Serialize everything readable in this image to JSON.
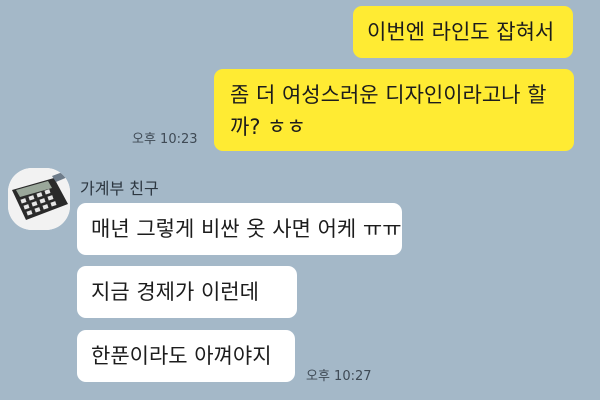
{
  "chat": {
    "sent": [
      {
        "text": "이번엔 라인도 잡혀서"
      },
      {
        "text": "좀 더 여성스러운 디자인이라고나 할까? ㅎㅎ"
      }
    ],
    "sent_time": "오후 10:23",
    "friend_name": "가계부 친구",
    "avatar_icon": "calculator-icon",
    "received": [
      {
        "text": "매년 그렇게 비싼 옷 사면 어케 ㅠㅠ"
      },
      {
        "text": "지금 경제가 이런데"
      },
      {
        "text": "한푼이라도 아껴야지"
      }
    ],
    "received_time": "오후 10:27"
  },
  "colors": {
    "background": "#a4b8c8",
    "sent_bubble": "#ffeb33",
    "received_bubble": "#ffffff"
  }
}
